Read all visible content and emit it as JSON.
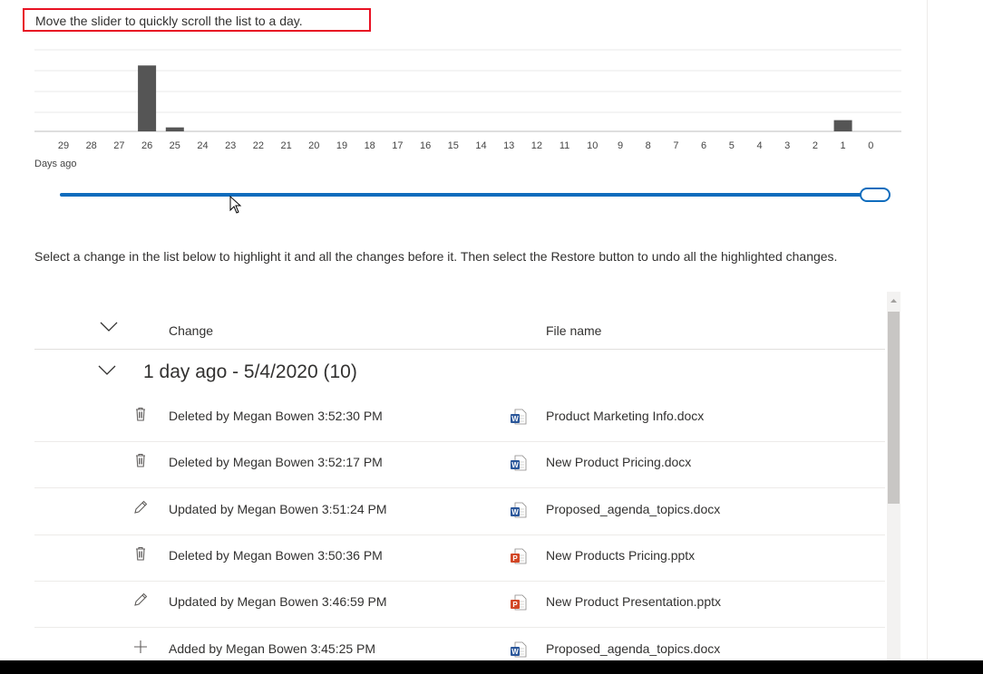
{
  "slider_hint": "Move the slider to quickly scroll the list to a day.",
  "chart_data": {
    "type": "bar",
    "categories": [
      "29",
      "28",
      "27",
      "26",
      "25",
      "24",
      "23",
      "22",
      "21",
      "20",
      "19",
      "18",
      "17",
      "16",
      "15",
      "14",
      "13",
      "12",
      "11",
      "10",
      "9",
      "8",
      "7",
      "6",
      "5",
      "4",
      "3",
      "2",
      "1",
      "0"
    ],
    "values": [
      0,
      0,
      0,
      10,
      0.6,
      0,
      0,
      0,
      0,
      0,
      0,
      0,
      0,
      0,
      0,
      0,
      0,
      0,
      0,
      0,
      0,
      0,
      0,
      0,
      0,
      0,
      0,
      0,
      1.7,
      0
    ],
    "xlabel": "Days ago",
    "ylim": [
      0,
      11
    ],
    "grid": true,
    "bar_color": "#555555"
  },
  "slider": {
    "position": 1.0,
    "accent": "#0f6cbd"
  },
  "instructions": "Select a change in the list below to highlight it and all the changes before it. Then select the Restore button to undo all the highlighted changes.",
  "list": {
    "columns": {
      "change": "Change",
      "file_name": "File name"
    },
    "group_title": "1 day ago - 5/4/2020 (10)",
    "rows": [
      {
        "action_icon": "trash-icon",
        "change": "Deleted by Megan Bowen 3:52:30 PM",
        "file_icon": "word-doc-icon",
        "file": "Product Marketing Info.docx"
      },
      {
        "action_icon": "trash-icon",
        "change": "Deleted by Megan Bowen 3:52:17 PM",
        "file_icon": "word-doc-icon",
        "file": "New Product Pricing.docx"
      },
      {
        "action_icon": "pencil-icon",
        "change": "Updated by Megan Bowen 3:51:24 PM",
        "file_icon": "word-doc-icon",
        "file": "Proposed_agenda_topics.docx"
      },
      {
        "action_icon": "trash-icon",
        "change": "Deleted by Megan Bowen 3:50:36 PM",
        "file_icon": "powerpoint-doc-icon",
        "file": "New Products Pricing.pptx"
      },
      {
        "action_icon": "pencil-icon",
        "change": "Updated by Megan Bowen 3:46:59 PM",
        "file_icon": "powerpoint-doc-icon",
        "file": "New Product Presentation.pptx"
      },
      {
        "action_icon": "plus-icon",
        "change": "Added by Megan Bowen 3:45:25 PM",
        "file_icon": "word-doc-icon",
        "file": "Proposed_agenda_topics.docx"
      }
    ]
  },
  "colors": {
    "word": "#2b579a",
    "powerpoint": "#d24726",
    "accent": "#0f6cbd",
    "highlight_border": "#e81123"
  }
}
